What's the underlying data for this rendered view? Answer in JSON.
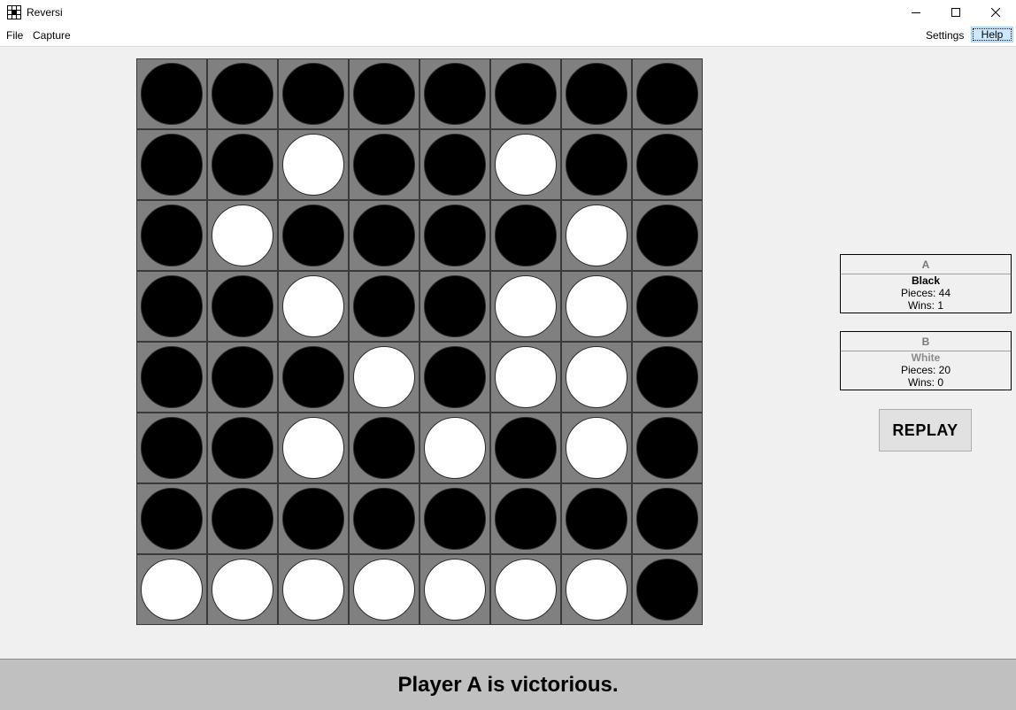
{
  "window": {
    "title": "Reversi",
    "icon": "reversi-app-icon"
  },
  "menu": {
    "file": "File",
    "capture": "Capture",
    "settings": "Settings",
    "help": "Help"
  },
  "board": {
    "rows": [
      [
        "B",
        "B",
        "B",
        "B",
        "B",
        "B",
        "B",
        "B"
      ],
      [
        "B",
        "B",
        "W",
        "B",
        "B",
        "W",
        "B",
        "B"
      ],
      [
        "B",
        "W",
        "B",
        "B",
        "B",
        "B",
        "W",
        "B"
      ],
      [
        "B",
        "B",
        "W",
        "B",
        "B",
        "W",
        "W",
        "B"
      ],
      [
        "B",
        "B",
        "B",
        "W",
        "B",
        "W",
        "W",
        "B"
      ],
      [
        "B",
        "B",
        "W",
        "B",
        "W",
        "B",
        "W",
        "B"
      ],
      [
        "B",
        "B",
        "B",
        "B",
        "B",
        "B",
        "B",
        "B"
      ],
      [
        "W",
        "W",
        "W",
        "W",
        "W",
        "W",
        "W",
        "B"
      ]
    ],
    "colors": {
      "cell": "#808080",
      "black": "#000000",
      "white": "#ffffff"
    }
  },
  "players": {
    "a": {
      "name": "A",
      "color": "Black",
      "pieces": "Pieces: 44",
      "wins": "Wins: 1"
    },
    "b": {
      "name": "B",
      "color": "White",
      "pieces": "Pieces: 20",
      "wins": "Wins: 0"
    }
  },
  "replay_label": "REPLAY",
  "status": "Player A is victorious."
}
